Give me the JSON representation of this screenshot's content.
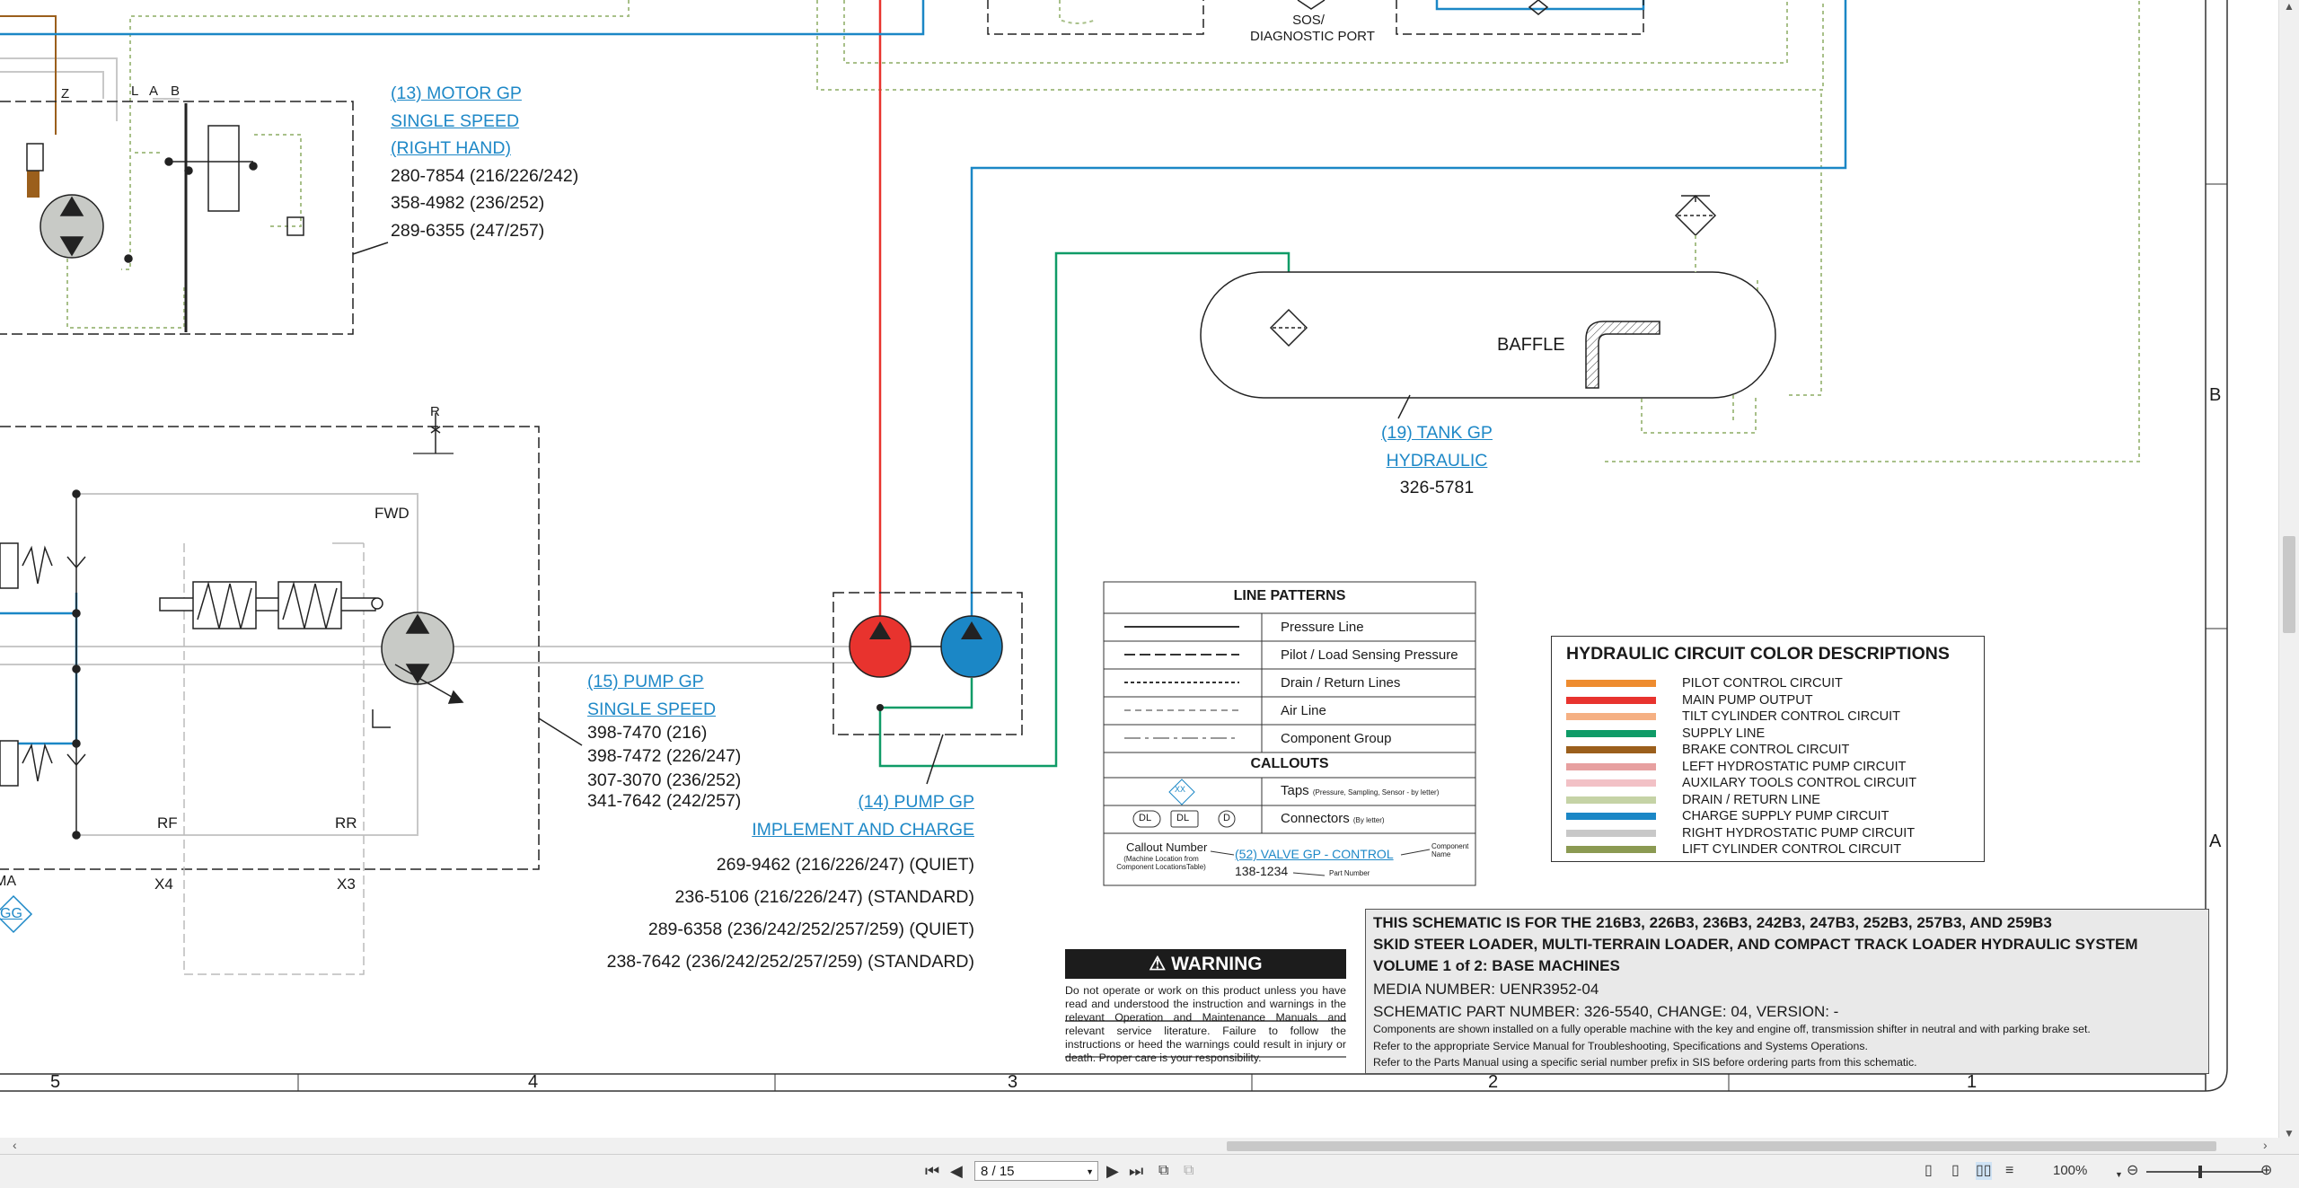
{
  "colors": {
    "pressure_red": "#e8332e",
    "charge_blue": "#1b87c6",
    "supply_green": "#0f9b67",
    "drain_dotted": "#a8c089",
    "pilot_orange": "#ee8c2f",
    "brake_brown": "#9b5f1c",
    "tilt_peach": "#f5b083",
    "left_hydro_pink": "#e7a0a0",
    "aux_pink": "#f2c1c6",
    "right_hydro_gray": "#c8c8c8",
    "lift_olive": "#8b9a52",
    "link_blue": "#1e88c7"
  },
  "top": {
    "sos_label": "SOS/\nDIAGNOSTIC PORT",
    "sos_line1": "SOS/",
    "sos_line2": "DIAGNOSTIC PORT"
  },
  "motor_gp": {
    "port_labels": [
      "Z",
      "L",
      "A",
      "B"
    ],
    "callout_lines": [
      "(13) MOTOR GP",
      "SINGLE SPEED",
      "(RIGHT HAND)"
    ],
    "parts": [
      "280-7854 (216/226/242)",
      "358-4982 (236/252)",
      "289-6355 (247/257)"
    ]
  },
  "tank_gp": {
    "baffle_label": "BAFFLE",
    "callout_lines": [
      "(19) TANK GP",
      "HYDRAULIC"
    ],
    "part": "326-5781"
  },
  "pump15": {
    "port_r": "R",
    "fwd": "FWD",
    "rf": "RF",
    "rr": "RR",
    "x4": "X4",
    "x3": "X3",
    "ma": "MA",
    "gg": "GG",
    "callout_lines": [
      "(15) PUMP GP",
      "SINGLE SPEED"
    ],
    "parts": [
      "398-7470 (216)",
      "398-7472 (226/247)",
      "307-3070 (236/252)",
      "341-7642 (242/257)"
    ]
  },
  "pump14": {
    "callout_lines": [
      "(14) PUMP GP",
      "IMPLEMENT AND CHARGE"
    ],
    "parts": [
      "269-9462 (216/226/247) (QUIET)",
      "236-5106 (216/226/247) (STANDARD)",
      "289-6358 (236/242/252/257/259) (QUIET)",
      "238-7642 (236/242/252/257/259) (STANDARD)"
    ]
  },
  "line_patterns": {
    "title": "LINE PATTERNS",
    "rows": [
      "Pressure Line",
      "Pilot / Load Sensing Pressure",
      "Drain / Return Lines",
      "Air Line",
      "Component Group"
    ],
    "callouts_title": "CALLOUTS",
    "taps_label": "Taps",
    "taps_note": "(Pressure, Sampling, Sensor - by letter)",
    "taps_symbol": "XX",
    "connectors_label": "Connectors",
    "connectors_note": "(By letter)",
    "conn_symbols": [
      "DL",
      "DL",
      "D"
    ],
    "example_callout_label": "Callout Number",
    "example_callout_note": "(Machine Location from Component LocationsTable)",
    "example_link": "(52) VALVE GP - CONTROL",
    "example_part": "138-1234",
    "component_name": "Component Name",
    "part_number": "Part Number"
  },
  "color_desc": {
    "title": "HYDRAULIC CIRCUIT COLOR DESCRIPTIONS",
    "items": [
      {
        "label": "PILOT CONTROL CIRCUIT",
        "color": "#ee8c2f"
      },
      {
        "label": "MAIN PUMP OUTPUT",
        "color": "#e8332e"
      },
      {
        "label": "TILT CYLINDER CONTROL CIRCUIT",
        "color": "#f5b083"
      },
      {
        "label": "SUPPLY LINE",
        "color": "#0f9b67"
      },
      {
        "label": "BRAKE CONTROL CIRCUIT",
        "color": "#9b5f1c"
      },
      {
        "label": "LEFT HYDROSTATIC PUMP CIRCUIT",
        "color": "#e7a0a0"
      },
      {
        "label": "AUXILARY TOOLS CONTROL CIRCUIT",
        "color": "#f2c1c6"
      },
      {
        "label": "DRAIN / RETURN LINE",
        "color": "#c5d3a6"
      },
      {
        "label": "CHARGE SUPPLY PUMP CIRCUIT",
        "color": "#1b87c6"
      },
      {
        "label": "RIGHT HYDROSTATIC PUMP CIRCUIT",
        "color": "#c8c8c8"
      },
      {
        "label": "LIFT CYLINDER CONTROL CIRCUIT",
        "color": "#8b9a52"
      }
    ]
  },
  "warning": {
    "title": "WARNING",
    "text": "Do not operate or work on this product unless you have read and understood the instruction and warnings in the relevant Operation and Maintenance Manuals and relevant service literature. Failure to follow the instructions or heed the warnings could result in injury or death. Proper care is your responsibility."
  },
  "title_block": {
    "line1": "THIS SCHEMATIC IS FOR THE 216B3, 226B3, 236B3, 242B3, 247B3, 252B3, 257B3, AND 259B3",
    "line2": "SKID STEER LOADER, MULTI-TERRAIN LOADER, AND COMPACT TRACK LOADER HYDRAULIC SYSTEM",
    "line3": "VOLUME 1 of 2: BASE MACHINES",
    "media": "MEDIA NUMBER: UENR3952-04",
    "schematic": "SCHEMATIC PART NUMBER: 326-5540, CHANGE: 04, VERSION: -",
    "note1": "Components are shown installed on a fully operable machine with the key and engine off, transmission shifter in neutral and with parking brake set.",
    "note2": "Refer to the appropriate Service Manual for Troubleshooting, Specifications and Systems Operations.",
    "note3": "Refer to the Parts Manual using a specific serial number prefix in SIS before ordering parts from this schematic."
  },
  "grid": {
    "columns": [
      "5",
      "4",
      "3",
      "2",
      "1"
    ],
    "rows": [
      "B",
      "A"
    ]
  },
  "viewer": {
    "page_field": "8 / 15",
    "zoom": "100%"
  }
}
